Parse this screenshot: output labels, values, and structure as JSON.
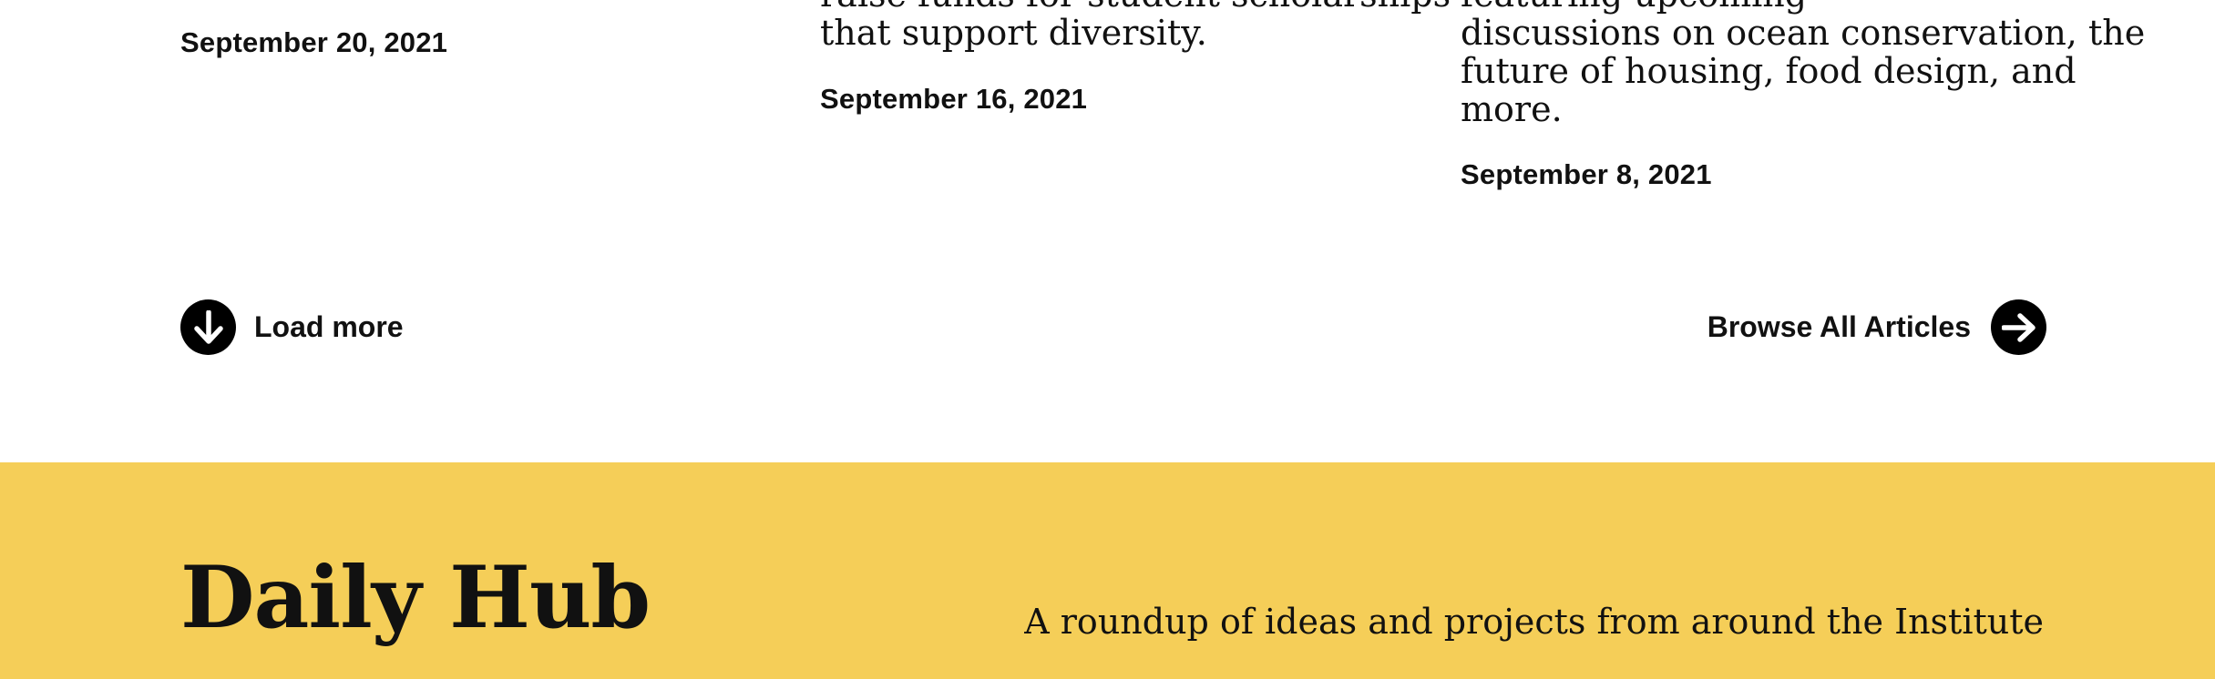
{
  "articles": [
    {
      "snippet_lines": [],
      "date": "September 20, 2021"
    },
    {
      "snippet_lines": [
        "raise funds for student scholarships",
        "that support diversity."
      ],
      "date": "September 16, 2021"
    },
    {
      "snippet_lines": [
        "featuring upcoming",
        "discussions on ocean conservation, the",
        "future of housing, food design, and",
        "more."
      ],
      "date": "September 8, 2021"
    }
  ],
  "actions": {
    "load_more_label": "Load more",
    "load_more_icon": "arrow-down-circle-icon",
    "browse_label": "Browse All Articles",
    "browse_icon": "arrow-right-circle-icon"
  },
  "daily_hub": {
    "title": "Daily Hub",
    "tagline": "A roundup of ideas and projects from around the Institute",
    "background_color": "#F5CE58"
  },
  "colors": {
    "text": "#111111",
    "icon_circle": "#000000",
    "page_background": "#FFFFFF"
  }
}
